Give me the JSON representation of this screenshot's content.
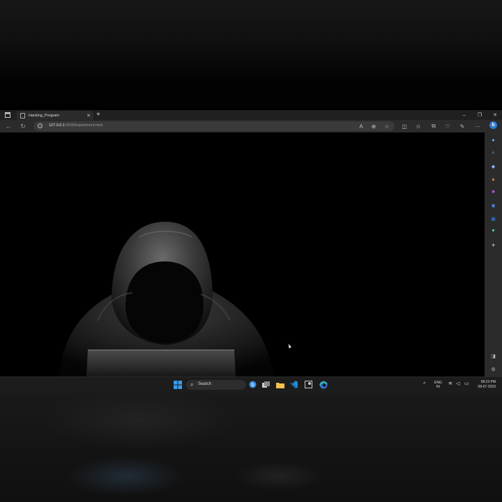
{
  "browser": {
    "tab": {
      "title": "Hacking_Program"
    },
    "address": {
      "host": "127.0.0.1",
      "path": ":5500/experiment.html"
    }
  },
  "taskbar": {
    "search_label": "Search",
    "language_line1": "ENG",
    "language_line2": "IN",
    "time": "08:23 PM",
    "date": "08-07-2023"
  },
  "colors": {
    "edge_blue": "#2f7ad6",
    "windows_blue": "#3a9cf0",
    "vscode_blue": "#1f8ad6",
    "folder_yellow": "#f2c14e"
  },
  "icons": {
    "tab_actions": "tab-actions-icon",
    "sidebar": [
      "copilot-icon",
      "discover-icon",
      "search-icon",
      "tools-icon",
      "shopping-icon",
      "games-icon",
      "outlook-icon",
      "office-icon",
      "drop-icon",
      "add-icon",
      "hide-sidebar-icon",
      "settings-icon"
    ]
  }
}
